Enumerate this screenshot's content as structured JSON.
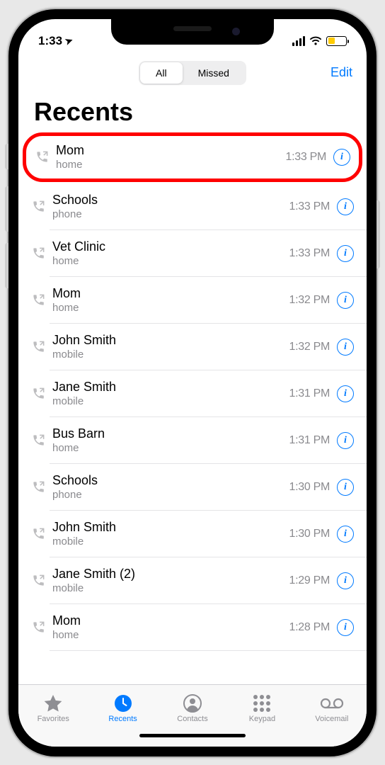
{
  "statusBar": {
    "time": "1:33",
    "locationGlyph": "➤"
  },
  "navBar": {
    "segments": {
      "all": "All",
      "missed": "Missed"
    },
    "edit": "Edit"
  },
  "title": "Recents",
  "calls": [
    {
      "name": "Mom",
      "sub": "home",
      "time": "1:33 PM",
      "highlighted": true
    },
    {
      "name": "Schools",
      "sub": "phone",
      "time": "1:33 PM"
    },
    {
      "name": "Vet Clinic",
      "sub": "home",
      "time": "1:33 PM"
    },
    {
      "name": "Mom",
      "sub": "home",
      "time": "1:32 PM"
    },
    {
      "name": "John Smith",
      "sub": "mobile",
      "time": "1:32 PM"
    },
    {
      "name": "Jane Smith",
      "sub": "mobile",
      "time": "1:31 PM"
    },
    {
      "name": "Bus Barn",
      "sub": "home",
      "time": "1:31 PM"
    },
    {
      "name": "Schools",
      "sub": "phone",
      "time": "1:30 PM"
    },
    {
      "name": "John Smith",
      "sub": "mobile",
      "time": "1:30 PM"
    },
    {
      "name": "Jane Smith (2)",
      "sub": "mobile",
      "time": "1:29 PM"
    },
    {
      "name": "Mom",
      "sub": "home",
      "time": "1:28 PM"
    }
  ],
  "infoGlyph": "i",
  "tabs": {
    "favorites": "Favorites",
    "recents": "Recents",
    "contacts": "Contacts",
    "keypad": "Keypad",
    "voicemail": "Voicemail"
  }
}
